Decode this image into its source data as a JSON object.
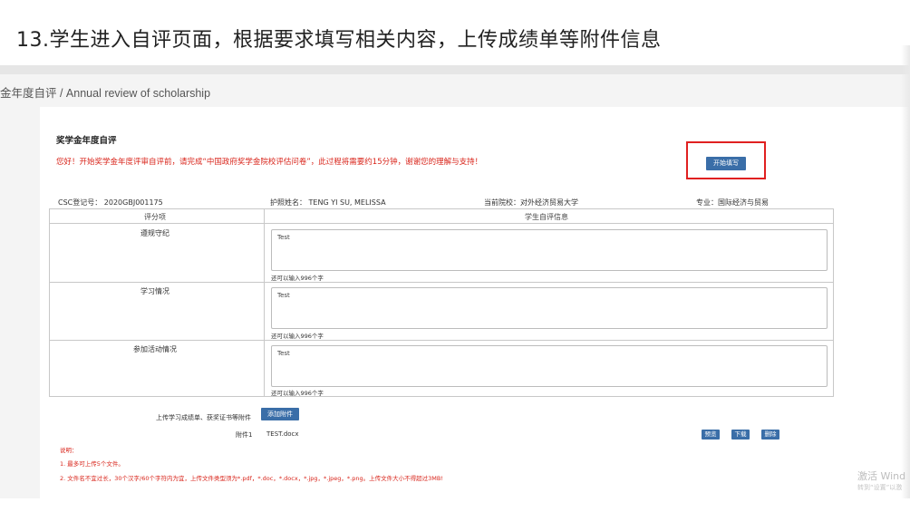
{
  "slide": {
    "title": "13.学生进入自评页面，根据要求填写相关内容，上传成绩单等附件信息"
  },
  "breadcrumb": {
    "text": "金年度自评 / Annual review of scholarship"
  },
  "form": {
    "section_title": "奖学金年度自评",
    "notice": "您好！开始奖学金年度评审自评前，请完成“中国政府奖学金院校评估问卷”，此过程将需要约15分钟，谢谢您的理解与支持！",
    "start_button": "开始填写",
    "info": {
      "csc": "CSC登记号：  2020GBJ001175",
      "name": "护照姓名：  TENG YI SU, MELISSA",
      "school": "当前院校：对外经济贸易大学",
      "major": "专业：国际经济与贸易"
    },
    "table": {
      "header_left": "评分项",
      "header_right": "学生自评信息",
      "rows": [
        {
          "label": "遵规守纪",
          "value": "Test",
          "remaining": "还可以输入996个字"
        },
        {
          "label": "学习情况",
          "value": "Test",
          "remaining": "还可以输入996个字"
        },
        {
          "label": "参加活动情况",
          "value": "Test",
          "remaining": "还可以输入996个字"
        }
      ]
    },
    "upload": {
      "label": "上传学习成绩单、获奖证书等附件",
      "add_button": "添加附件",
      "attachment_label": "附件1",
      "attachment_file": "TEST.docx",
      "preview_button": "预览",
      "download_button": "下载",
      "delete_button": "删除"
    },
    "notes": {
      "head": "说明：",
      "item1": "1. 最多可上传5个文件。",
      "item2": "2. 文件名不宜过长，30个汉字/60个字符内为宜，上传文件类型须为*.pdf，*.doc，*.docx，*.jpg，*.jpeg，*.png。上传文件大小不得超过3MB!"
    }
  },
  "watermark": {
    "line1": "激活 Wind",
    "line2": "转到“设置”以激"
  },
  "colors": {
    "accent_button": "#3a6ea8",
    "warning_text": "#d9261c",
    "highlight_border": "#e02020"
  }
}
